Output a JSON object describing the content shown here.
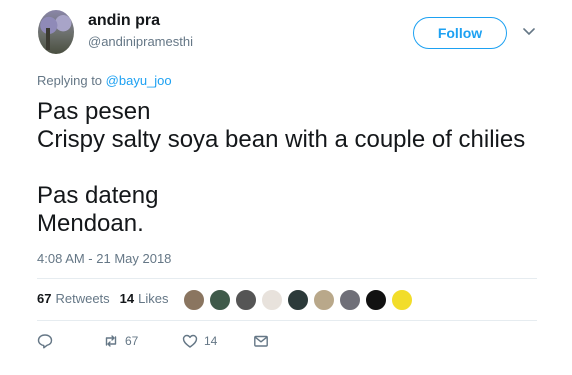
{
  "user": {
    "name": "andin pra",
    "handle": "@andinipramesthi"
  },
  "follow_label": "Follow",
  "reply_context": {
    "prefix": "Replying to",
    "mention": "@bayu_joo"
  },
  "tweet_lines": [
    "Pas pesen",
    "Crispy salty soya bean with a couple of chilies",
    "",
    "Pas dateng",
    "Mendoan."
  ],
  "timestamp": "4:08 AM - 21 May 2018",
  "stats": {
    "retweets_count": "67",
    "retweets_label": "Retweets",
    "likes_count": "14",
    "likes_label": "Likes"
  },
  "actions": {
    "reply_count": "",
    "retweet_count": "67",
    "like_count": "14"
  },
  "colors": {
    "accent": "#1da1f2",
    "muted": "#657786",
    "divider": "#e6ecf0"
  },
  "liker_avatars": [
    "#8a7560",
    "#3f5a4a",
    "#555555",
    "#e8e2dc",
    "#2c3a3a",
    "#b9a88a",
    "#6f6f78",
    "#111111",
    "#f2dd2a"
  ]
}
